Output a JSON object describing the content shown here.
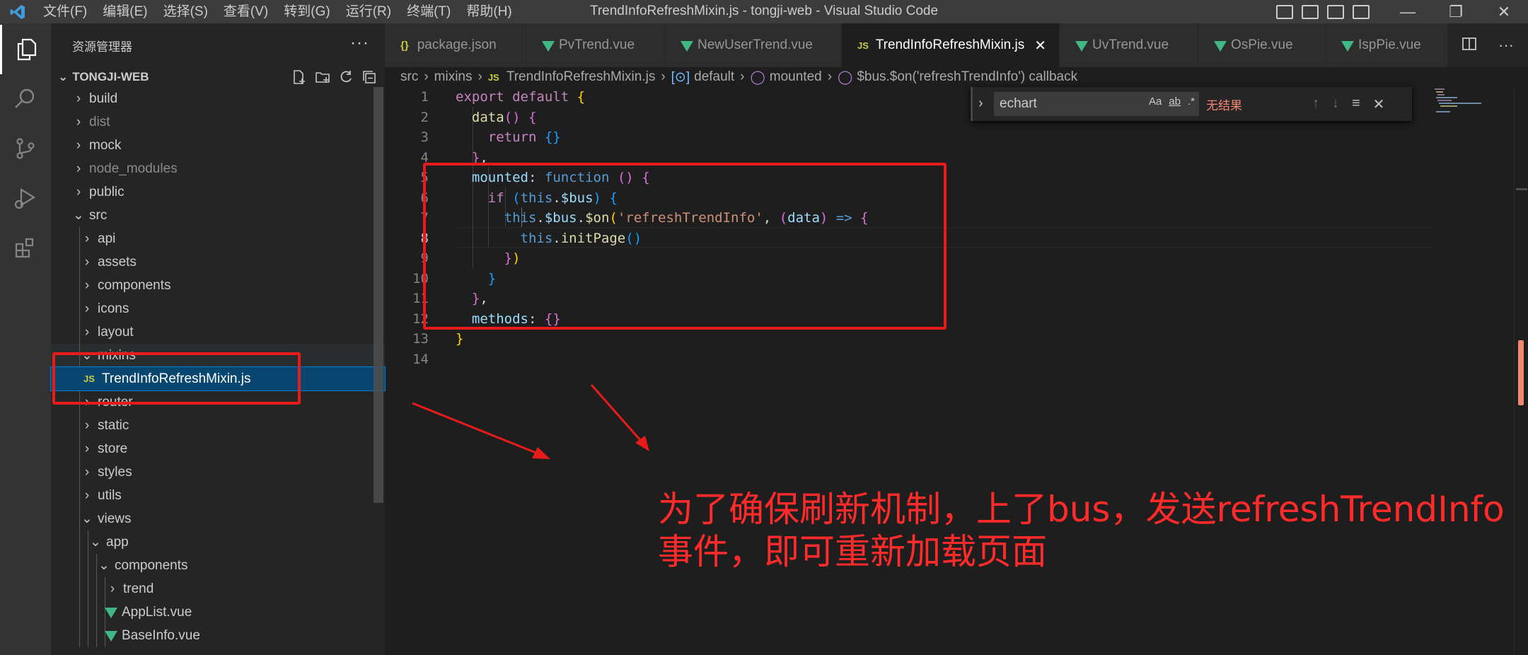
{
  "titlebar": {
    "menus": [
      "文件(F)",
      "编辑(E)",
      "选择(S)",
      "查看(V)",
      "转到(G)",
      "运行(R)",
      "终端(T)",
      "帮助(H)"
    ],
    "title": "TrendInfoRefreshMixin.js - tongji-web - Visual Studio Code"
  },
  "sidebar": {
    "header": "资源管理器",
    "project": "TONGJI-WEB",
    "tree": [
      {
        "label": "build"
      },
      {
        "label": "dist"
      },
      {
        "label": "mock"
      },
      {
        "label": "node_modules"
      },
      {
        "label": "public"
      },
      {
        "label": "src"
      },
      {
        "label": "api"
      },
      {
        "label": "assets"
      },
      {
        "label": "components"
      },
      {
        "label": "icons"
      },
      {
        "label": "layout"
      },
      {
        "label": "mixins"
      },
      {
        "label": "TrendInfoRefreshMixin.js"
      },
      {
        "label": "router"
      },
      {
        "label": "static"
      },
      {
        "label": "store"
      },
      {
        "label": "styles"
      },
      {
        "label": "utils"
      },
      {
        "label": "views"
      },
      {
        "label": "app"
      },
      {
        "label": "components"
      },
      {
        "label": "trend"
      },
      {
        "label": "AppList.vue"
      },
      {
        "label": "BaseInfo.vue"
      }
    ]
  },
  "tabs": [
    {
      "label": "package.json"
    },
    {
      "label": "PvTrend.vue"
    },
    {
      "label": "NewUserTrend.vue"
    },
    {
      "label": "TrendInfoRefreshMixin.js"
    },
    {
      "label": "UvTrend.vue"
    },
    {
      "label": "OsPie.vue"
    },
    {
      "label": "IspPie.vue"
    }
  ],
  "breadcrumb": {
    "src": "src",
    "mixins": "mixins",
    "file": "TrendInfoRefreshMixin.js",
    "default": "default",
    "mounted": "mounted",
    "callback": "$bus.$on('refreshTrendInfo') callback"
  },
  "find": {
    "query": "echart",
    "result": "无结果",
    "case": "Aa",
    "word": "ab",
    "regex": ".*"
  },
  "code_line_numbers": [
    "1",
    "2",
    "3",
    "4",
    "5",
    "6",
    "7",
    "8",
    "9",
    "10",
    "11",
    "12",
    "13",
    "14"
  ],
  "annotation": {
    "text": "为了确保刷新机制，上了bus，发送refreshTrendInfo事件，即可重新加载页面"
  },
  "colors": {
    "annotation_red": "#e81b1b",
    "vue_green": "#41b883",
    "js_yellow": "#cbcb41"
  }
}
